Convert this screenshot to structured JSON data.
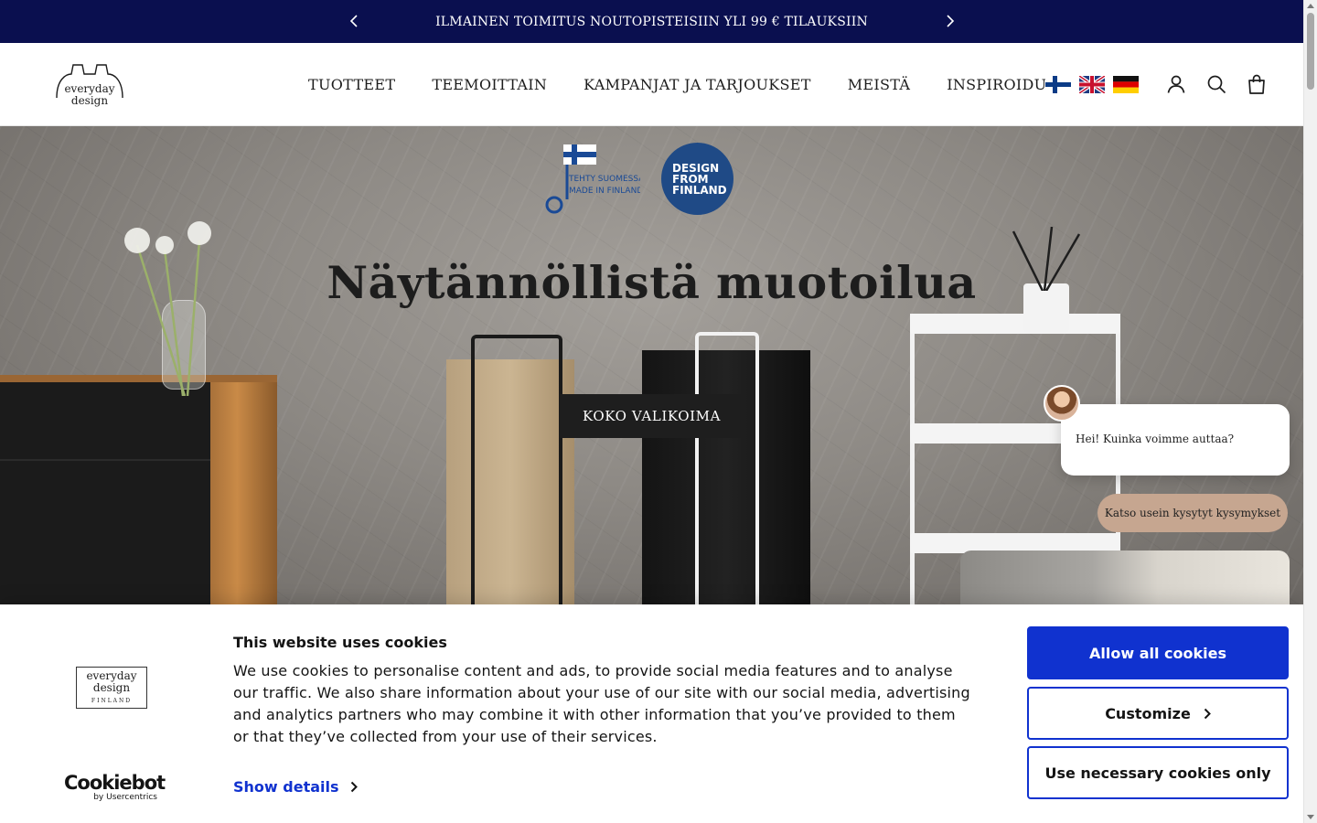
{
  "announcement": {
    "text": "ILMAINEN TOIMITUS NOUTOPISTEISIIN YLI 99 € TILAUKSIIN",
    "prev_icon": "chevron-left-icon",
    "next_icon": "chevron-right-icon"
  },
  "header": {
    "logo_text_line1": "everyday",
    "logo_text_line2": "design",
    "nav": [
      "TUOTTEET",
      "TEEMOITTAIN",
      "KAMPANJAT JA TARJOUKSET",
      "MEISTÄ",
      "INSPIROIDU"
    ],
    "languages": [
      "fi",
      "en",
      "de"
    ],
    "icons": [
      "account-icon",
      "search-icon",
      "cart-icon"
    ]
  },
  "hero": {
    "badge_key_line1": "TEHTY SUOMESSA",
    "badge_key_line2": "MADE IN FINLAND",
    "badge_dff_lines": [
      "DESIGN",
      "FROM",
      "FINLAND"
    ],
    "title": "Näytännöllistä muotoilua",
    "cta": "KOKO VALIKOIMA"
  },
  "chat": {
    "greeting": "Hei! Kuinka voimme auttaa?",
    "faq_button": "Katso usein kysytyt kysymykset"
  },
  "cookie_banner": {
    "title": "This website uses cookies",
    "body": "We use cookies to personalise content and ads, to provide social media features and to analyse our traffic. We also share information about your use of our site with our social media, advertising and analytics partners who may combine it with other information that you’ve provided to them or that they’ve collected from your use of their services.",
    "show_details": "Show details",
    "allow_all": "Allow all cookies",
    "customize": "Customize",
    "necessary_only": "Use necessary cookies only",
    "brand_logo_line1": "everyday",
    "brand_logo_line2": "design",
    "brand_logo_line3": "FINLAND",
    "provider_main": "Cookiebot",
    "provider_sub": "by Usercentrics",
    "accent_color": "#1032cf"
  }
}
